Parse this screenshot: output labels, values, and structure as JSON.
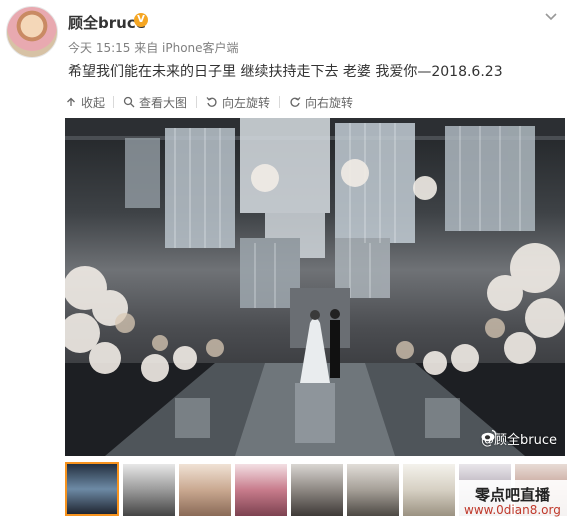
{
  "post": {
    "username": "顾全bruce",
    "verified_symbol": "V",
    "meta": "今天 15:15 来自 iPhone客户端",
    "text": "希望我们能在未来的日子里 继续扶持走下去 老婆 我爱你—2018.6.23"
  },
  "toolbar": {
    "collapse": "收起",
    "view_large": "查看大图",
    "rotate_left": "向左旋转",
    "rotate_right": "向右旋转"
  },
  "photo": {
    "watermark": "@顾全bruce",
    "icon": "weibo-logo-icon"
  },
  "thumbnails": {
    "count": 9,
    "active_index": 0
  },
  "overlay": {
    "title": "零点吧直播",
    "url": "www.0dian8.org"
  },
  "colors": {
    "accent": "#f7931e",
    "text": "#333333",
    "meta": "#808080",
    "url": "#c0392b"
  }
}
